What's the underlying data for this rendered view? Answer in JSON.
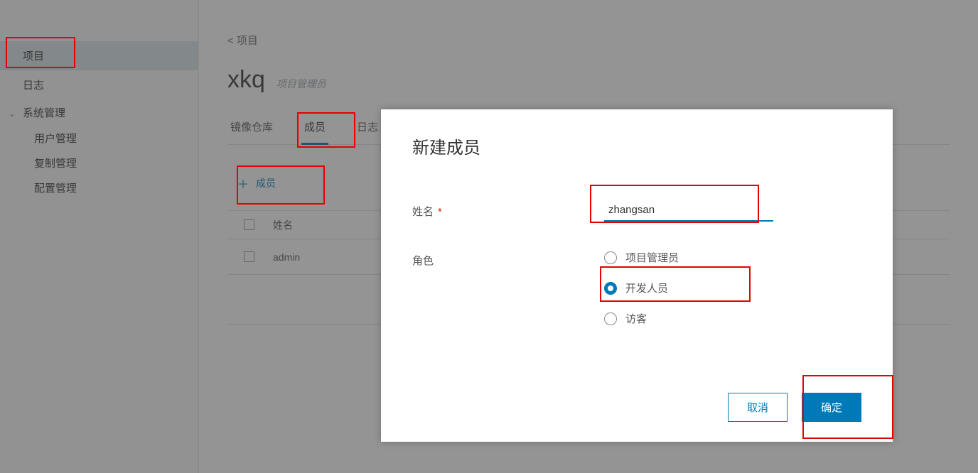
{
  "sidebar": {
    "items": [
      {
        "label": "项目"
      },
      {
        "label": "日志"
      }
    ],
    "group": {
      "label": "系统管理",
      "children": [
        {
          "label": "用户管理"
        },
        {
          "label": "复制管理"
        },
        {
          "label": "配置管理"
        }
      ]
    }
  },
  "main": {
    "back": "< 项目",
    "project_title": "xkq",
    "project_role": "项目管理员",
    "tabs": [
      {
        "label": "镜像仓库"
      },
      {
        "label": "成员"
      },
      {
        "label": "日志"
      }
    ],
    "add_button": "成员",
    "table": {
      "header_name": "姓名",
      "rows": [
        {
          "name": "admin"
        }
      ]
    }
  },
  "modal": {
    "title": "新建成员",
    "name_label": "姓名",
    "name_value": "zhangsan",
    "role_label": "角色",
    "roles": [
      {
        "label": "项目管理员",
        "checked": false
      },
      {
        "label": "开发人员",
        "checked": true
      },
      {
        "label": "访客",
        "checked": false
      }
    ],
    "cancel": "取消",
    "ok": "确定"
  }
}
